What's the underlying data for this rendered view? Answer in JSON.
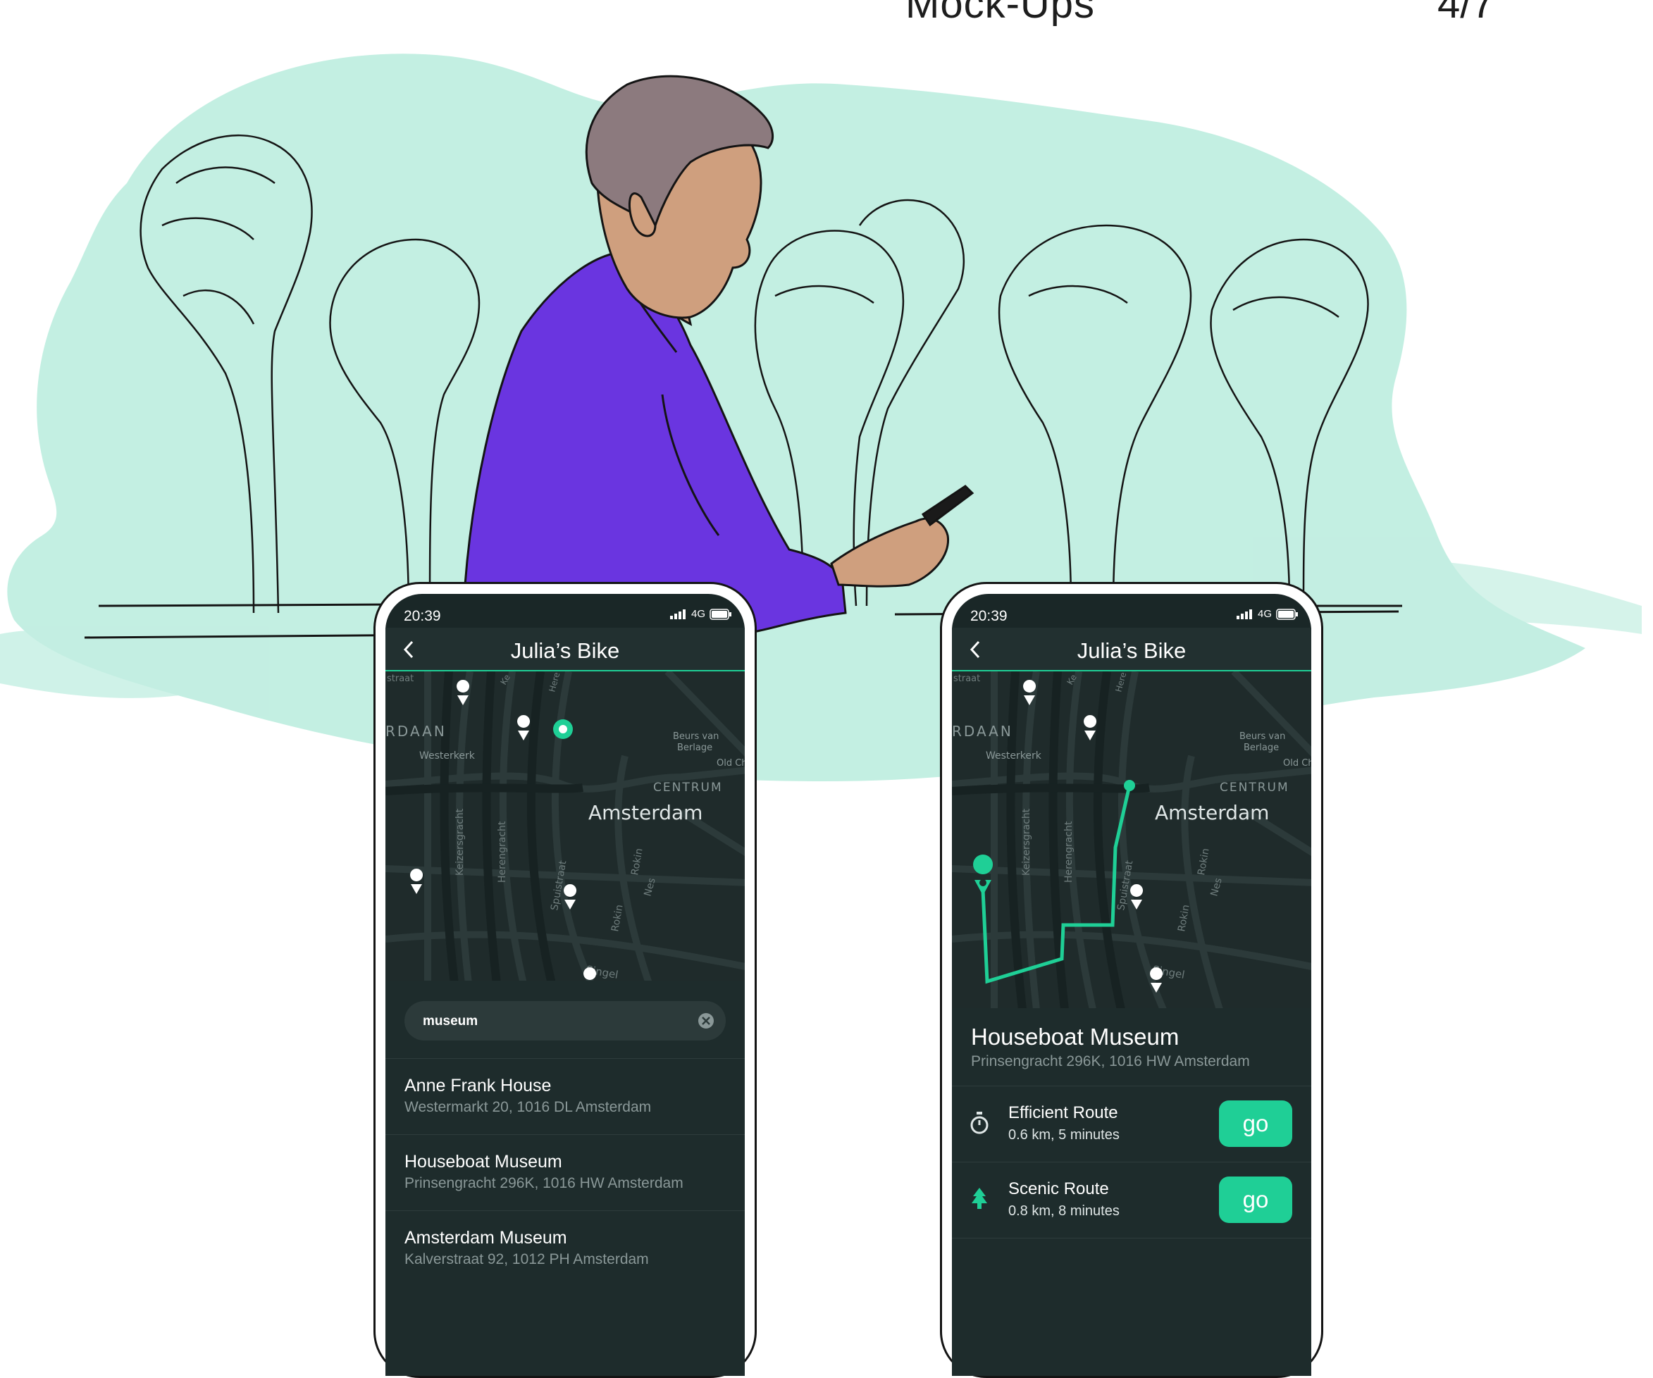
{
  "header": {
    "title": "Mock-Ups",
    "page": "4/7"
  },
  "colors": {
    "accent": "#1fcf96",
    "wash": "#aee6d6",
    "shirt": "#6a35e0",
    "screen_bg": "#1a2727"
  },
  "phones": [
    {
      "status": {
        "time": "20:39",
        "network": "4G"
      },
      "title": "Julia’s Bike",
      "map_labels": [
        "straat",
        "RDAAN",
        "Westerkerk",
        "Keizersgracht",
        "Herengracht",
        "Spuistraat",
        "Amsterdam",
        "CENTRUM",
        "Beurs van",
        "Berlage",
        "Old Ch",
        "Rokin",
        "Nes",
        "Rokin",
        "Singel",
        "Ke",
        "Here"
      ],
      "search": {
        "value": "museum"
      },
      "results": [
        {
          "title": "Anne Frank House",
          "address": "Westermarkt 20, 1016 DL Amsterdam"
        },
        {
          "title": "Houseboat Museum",
          "address": "Prinsengracht 296K, 1016 HW Amsterdam"
        },
        {
          "title": "Amsterdam Museum",
          "address": "Kalverstraat 92, 1012 PH Amsterdam"
        }
      ]
    },
    {
      "status": {
        "time": "20:39",
        "network": "4G"
      },
      "title": "Julia’s Bike",
      "map_labels": [
        "straat",
        "RDAAN",
        "Westerkerk",
        "Keizersgracht",
        "Herengracht",
        "Spuistraat",
        "Amsterdam",
        "CENTRUM",
        "Beurs van",
        "Berlage",
        "Old Ch",
        "Rokin",
        "Nes",
        "Rokin",
        "Singel",
        "Ke",
        "Here"
      ],
      "destination": {
        "title": "Houseboat Museum",
        "address": "Prinsengracht 296K, 1016 HW Amsterdam"
      },
      "routes": [
        {
          "name": "Efficient Route",
          "details": "0.6 km, 5 minutes",
          "icon": "stopwatch-icon",
          "action": "go"
        },
        {
          "name": "Scenic Route",
          "details": "0.8 km, 8 minutes",
          "icon": "tree-icon",
          "action": "go"
        }
      ]
    }
  ]
}
